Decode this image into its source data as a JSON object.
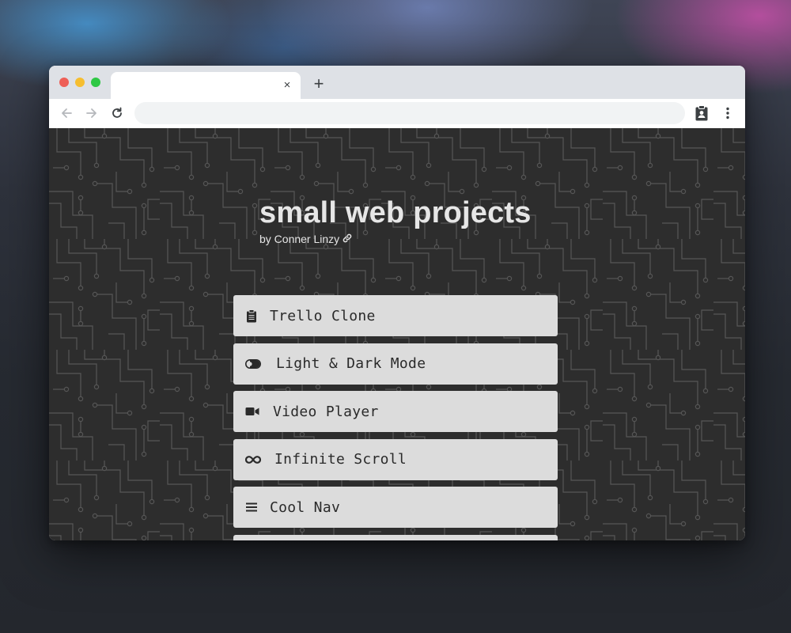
{
  "browser": {
    "tab_title": "",
    "tab_close_glyph": "×",
    "new_tab_glyph": "+",
    "address": "",
    "icons": [
      "back-arrow-icon",
      "forward-arrow-icon",
      "reload-icon",
      "clipboard-person-icon",
      "more-vert-icon"
    ]
  },
  "page": {
    "title": "small web projects",
    "byline": "by Conner Linzy",
    "byline_icon": "link-icon",
    "projects": [
      {
        "label": "Trello Clone",
        "icon": "clipboard-icon"
      },
      {
        "label": "Light & Dark Mode",
        "icon": "toggle-icon"
      },
      {
        "label": "Video Player",
        "icon": "video-camera-icon"
      },
      {
        "label": "Infinite Scroll",
        "icon": "infinity-icon"
      },
      {
        "label": "Cool Nav",
        "icon": "menu-icon"
      },
      {
        "label": "",
        "icon": ""
      }
    ]
  },
  "colors": {
    "page_background": "#2d2d2d",
    "circuit_lines": "#555555",
    "card_background": "#dcdcdc",
    "title_text": "#e6e6e6",
    "card_text": "#2a2a2a"
  }
}
